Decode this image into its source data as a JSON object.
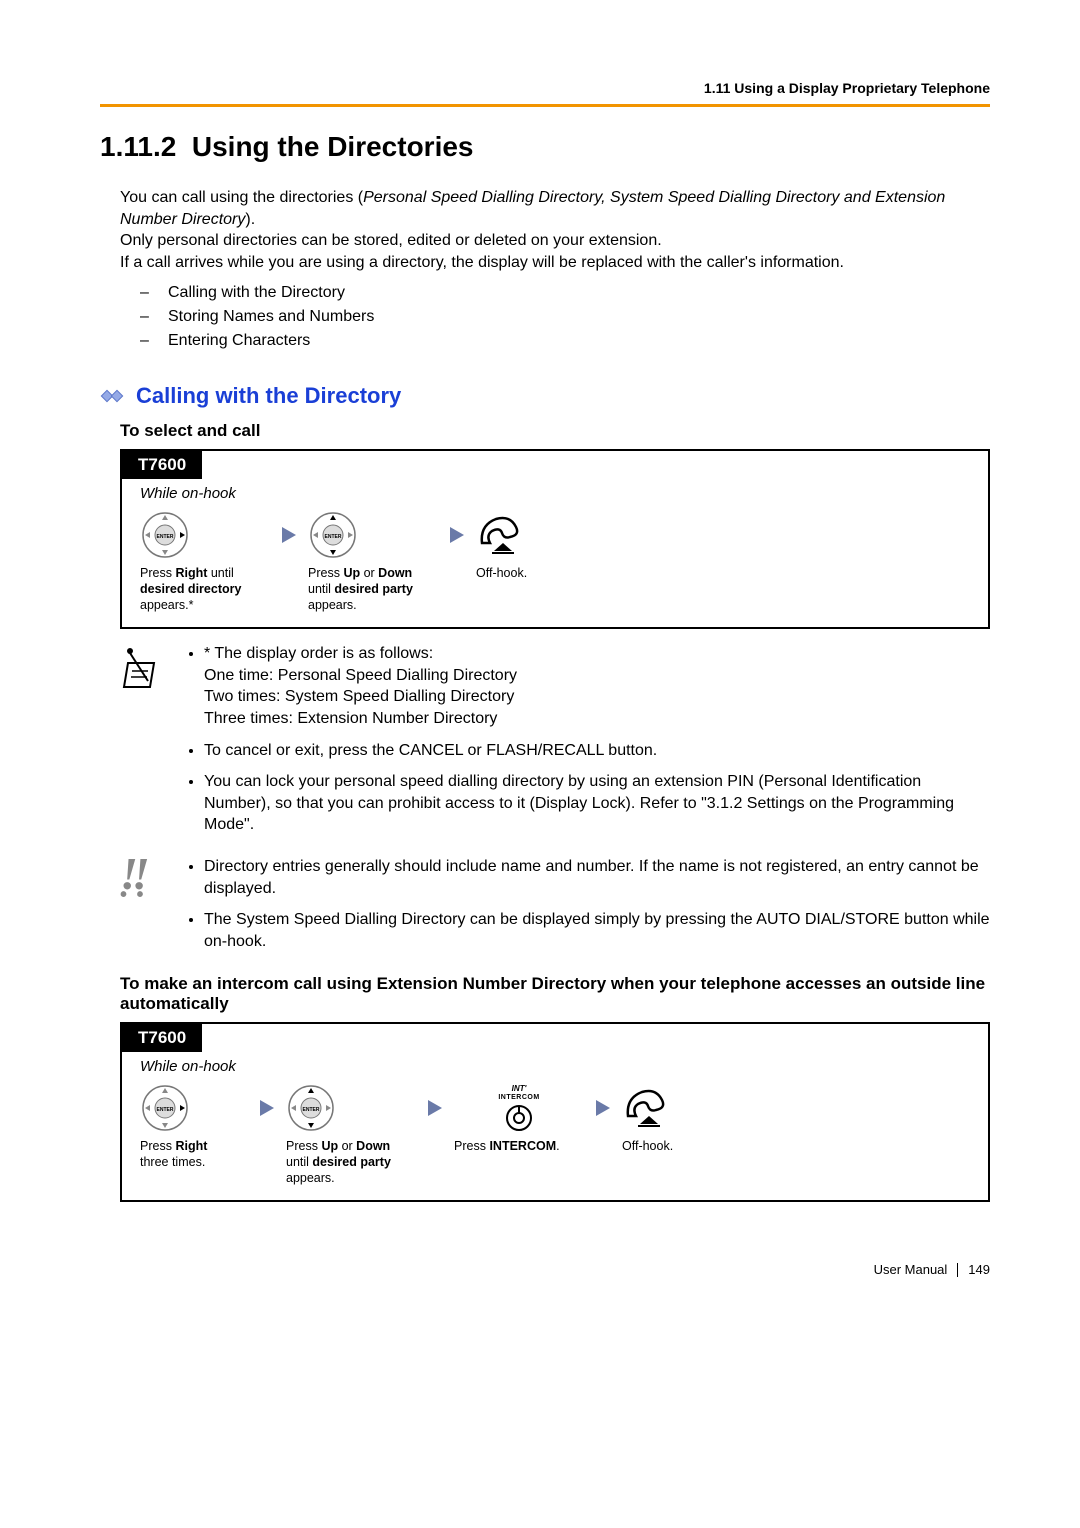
{
  "header": {
    "breadcrumb": "1.11 Using a Display Proprietary Telephone"
  },
  "section": {
    "number": "1.11.2",
    "title": "Using the Directories"
  },
  "intro": {
    "line1a": "You can call using the directories (",
    "line1b": "Personal Speed Dialling Directory, System Speed Dialling Directory and Extension Number Directory",
    "line1c": ").",
    "line2": "Only personal directories can be stored, edited or deleted on your extension.",
    "line3": "If a call arrives while you are using a directory, the display will be replaced with the caller's information."
  },
  "toc": [
    "Calling with the Directory",
    "Storing Names and Numbers",
    "Entering Characters"
  ],
  "subhead1": "Calling with the Directory",
  "proc1": {
    "heading": "To select and call",
    "model": "T7600",
    "while": "While on-hook",
    "step1": {
      "t1": "Press ",
      "t2": "Right",
      "t3": " until ",
      "t4": "desired directory",
      "t5": " appears.*"
    },
    "step2": {
      "t1": "Press ",
      "t2": "Up",
      "t3": " or ",
      "t4": "Down",
      "t5": " until ",
      "t6": "desired party",
      "t7": " appears."
    },
    "step3": {
      "t1": "Off-hook."
    }
  },
  "notes": {
    "n1a": "* The display order is as follows:",
    "n1b": "One time: Personal Speed Dialling Directory",
    "n1c": "Two times: System Speed Dialling Directory",
    "n1d": "Three times: Extension Number Directory",
    "n2": "To cancel or exit, press the CANCEL or FLASH/RECALL button.",
    "n3": "You can lock your personal speed dialling directory by using an extension PIN (Personal Identification Number), so that you can prohibit access to it (Display Lock). Refer to \"3.1.2 Settings on the Programming Mode\"."
  },
  "alerts": {
    "a1": "Directory entries generally should include name and number. If the name is not registered, an entry cannot be displayed.",
    "a2": "The System Speed Dialling Directory can be displayed simply by pressing the AUTO DIAL/STORE button while on-hook."
  },
  "proc2": {
    "heading": "To make an intercom call using Extension Number Directory when your telephone accesses an outside line automatically",
    "model": "T7600",
    "while": "While on-hook",
    "step1": {
      "t1": "Press ",
      "t2": "Right",
      "t3": " three times."
    },
    "step2": {
      "t1": "Press ",
      "t2": "Up",
      "t3": " or ",
      "t4": "Down",
      "t5": " until ",
      "t6": "desired party",
      "t7": " appears."
    },
    "step3": {
      "t1": "Press ",
      "t2": "INTERCOM",
      "t3": "."
    },
    "step4": {
      "t1": "Off-hook."
    },
    "intercom_label_top": "INT'",
    "intercom_label": "INTERCOM"
  },
  "footer": {
    "manual": "User Manual",
    "page": "149"
  }
}
